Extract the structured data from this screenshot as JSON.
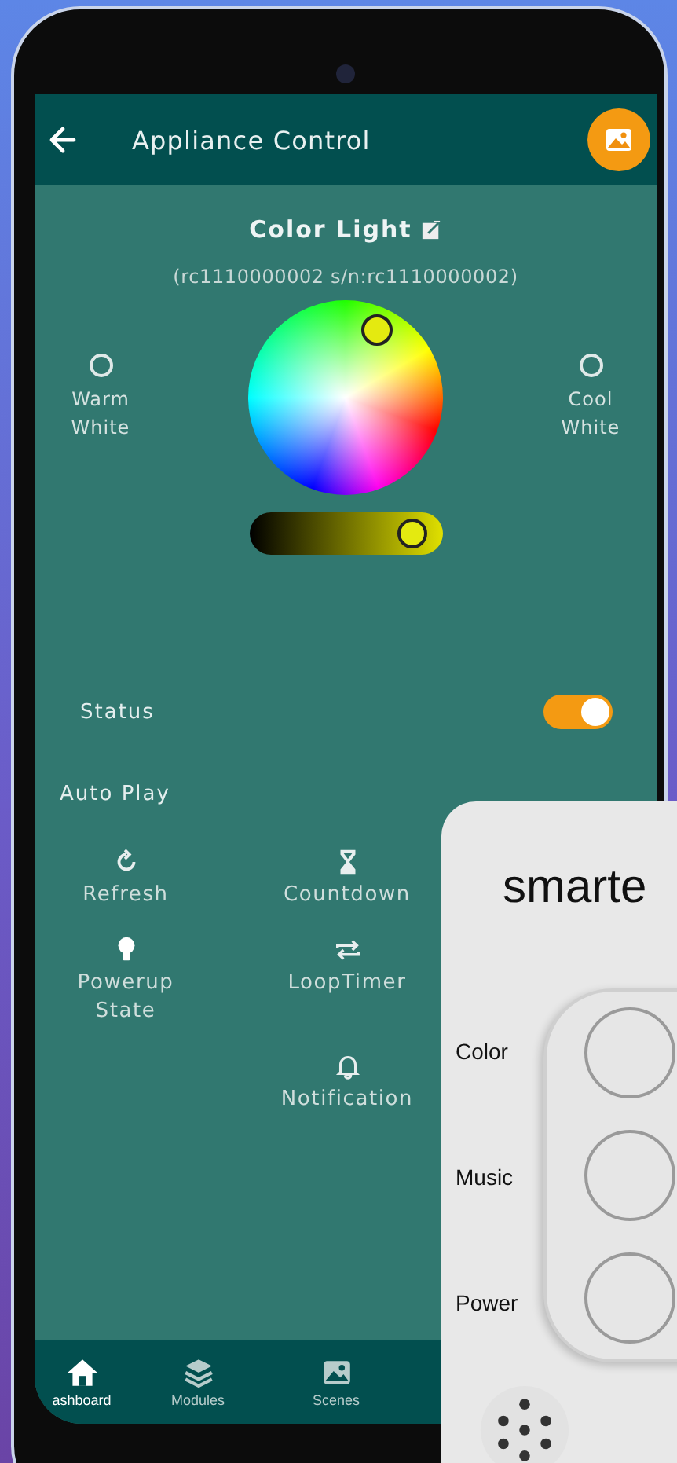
{
  "header": {
    "title": "Appliance Control"
  },
  "device": {
    "name": "Color Light",
    "serial": "(rc1110000002 s/n:rc1110000002)"
  },
  "white_modes": [
    {
      "label": "Warm White",
      "selected": false
    },
    {
      "label": "Cool White",
      "selected": false
    }
  ],
  "brightness": {
    "level": 0.87
  },
  "settings": [
    {
      "label": "Status",
      "kind": "toggle",
      "on": true
    },
    {
      "label": "Auto Play",
      "kind": "plain"
    }
  ],
  "actions": [
    {
      "label": "Refresh",
      "kind": "refresh"
    },
    {
      "label": "Countdown",
      "kind": "countdown"
    },
    {
      "label": "Powerup State",
      "kind": "bulb"
    },
    {
      "label": "LoopTimer",
      "kind": "loop"
    },
    {
      "label": "Notification",
      "kind": "bell"
    }
  ],
  "nav": [
    {
      "label": "ashboard",
      "kind": "home",
      "selected": true
    },
    {
      "label": "Modules",
      "kind": "layers",
      "selected": false
    },
    {
      "label": "Scenes",
      "kind": "image",
      "selected": false
    }
  ],
  "remote": {
    "title": "smarte",
    "buttons": [
      {
        "label": "Color"
      },
      {
        "label": "Music"
      },
      {
        "label": "Power"
      }
    ]
  }
}
